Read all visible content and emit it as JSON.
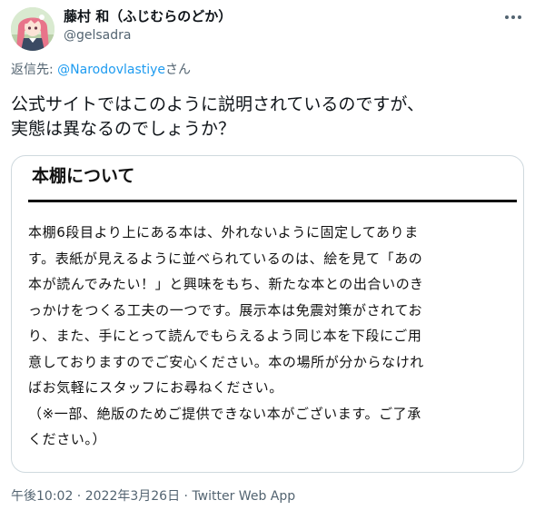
{
  "user": {
    "display_name": "藤村 和（ふじむらのどか）",
    "handle": "@gelsadra"
  },
  "reply": {
    "prefix": "返信先: ",
    "mention": "@Narodovlastiye",
    "suffix": "さん"
  },
  "tweet": {
    "lines": [
      "公式サイトではこのように説明されているのですが、",
      "実態は異なるのでしょうか？"
    ]
  },
  "image_notice": {
    "title": "本棚について",
    "lines": [
      "本棚6段目より上にある本は、外れないように固定してありま",
      "す。表紙が見えるように並べられているのは、絵を見て「あの",
      "本が読んでみたい！」と興味をもち、新たな本との出合いのき",
      "っかけをつくる工夫の一つです。展示本は免震対策がされてお",
      "り、また、手にとって読んでもらえるよう同じ本を下段にご用",
      "意しておりますのでご安心ください。本の場所が分からなけれ",
      "ばお気軽にスタッフにお尋ねください。",
      "（※一部、絶版のためご提供できない本がございます。ご了承",
      "ください。）"
    ]
  },
  "meta": {
    "time": "午後10:02",
    "separator": " · ",
    "date": "2022年3月26日",
    "source": "Twitter Web App"
  },
  "icons": {
    "more": "more-horizontal-icon",
    "avatar": "anime-avatar"
  },
  "colors": {
    "link": "#1d9bf0",
    "secondary_text": "#536471",
    "primary_text": "#0f1419",
    "card_border": "#cfd9de"
  }
}
